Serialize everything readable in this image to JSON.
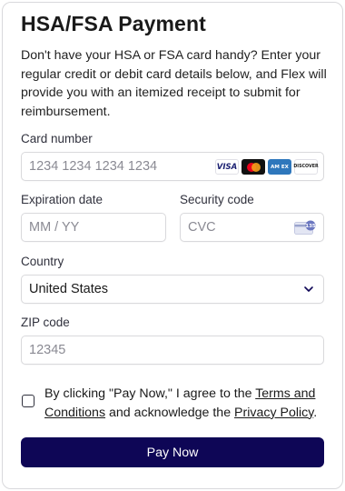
{
  "header": {
    "title": "HSA/FSA Payment",
    "intro": "Don't have your HSA or FSA card handy? Enter your regular credit or debit card details below, and Flex will provide you with an itemized receipt to submit for reimbursement."
  },
  "form": {
    "card_number": {
      "label": "Card number",
      "placeholder": "1234 1234 1234 1234"
    },
    "card_brands": [
      {
        "icon": "visa-icon",
        "text": "VISA"
      },
      {
        "icon": "mastercard-icon",
        "text": ""
      },
      {
        "icon": "amex-icon",
        "text": "AM EX"
      },
      {
        "icon": "discover-icon",
        "text": "DISCOVER"
      }
    ],
    "expiration": {
      "label": "Expiration date",
      "placeholder": "MM / YY"
    },
    "security": {
      "label": "Security code",
      "placeholder": "CVC",
      "icon": "cvc-card-icon",
      "icon_text": "135"
    },
    "country": {
      "label": "Country",
      "value": "United States",
      "icon": "chevron-down-icon"
    },
    "zip": {
      "label": "ZIP code",
      "placeholder": "12345"
    }
  },
  "consent": {
    "prefix": "By clicking \"Pay Now,\" I agree to the ",
    "terms_link": "Terms and Conditions",
    "middle": " and acknowledge the ",
    "privacy_link": "Privacy Policy",
    "suffix": "."
  },
  "actions": {
    "pay_label": "Pay Now"
  },
  "colors": {
    "primary": "#0e0656",
    "border": "#d9d9dc",
    "placeholder": "#8a8a93"
  }
}
